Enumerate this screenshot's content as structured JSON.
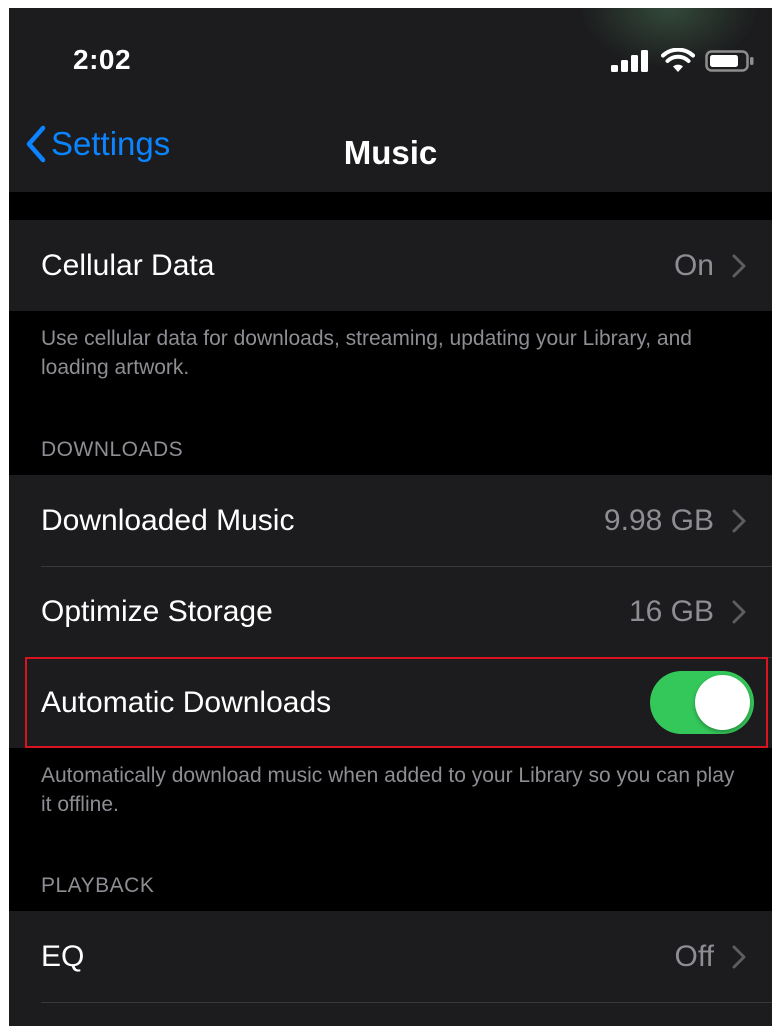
{
  "status": {
    "time": "2:02"
  },
  "nav": {
    "back_label": "Settings",
    "title": "Music"
  },
  "cellular": {
    "label": "Cellular Data",
    "value": "On",
    "footer": "Use cellular data for downloads, streaming, updating your Library, and loading artwork."
  },
  "downloads": {
    "header": "DOWNLOADS",
    "items": [
      {
        "label": "Downloaded Music",
        "value": "9.98 GB"
      },
      {
        "label": "Optimize Storage",
        "value": "16 GB"
      }
    ],
    "auto": {
      "label": "Automatic Downloads",
      "enabled": true
    },
    "footer": "Automatically download music when added to your Library so you can play it offline."
  },
  "playback": {
    "header": "PLAYBACK",
    "items": [
      {
        "label": "EQ",
        "value": "Off"
      }
    ]
  },
  "colors": {
    "accent": "#0a84ff",
    "toggle_on": "#34c759",
    "highlight": "#d7141f",
    "background": "#000000",
    "cell": "#1c1c1e",
    "secondary_text": "#8d8d93"
  }
}
